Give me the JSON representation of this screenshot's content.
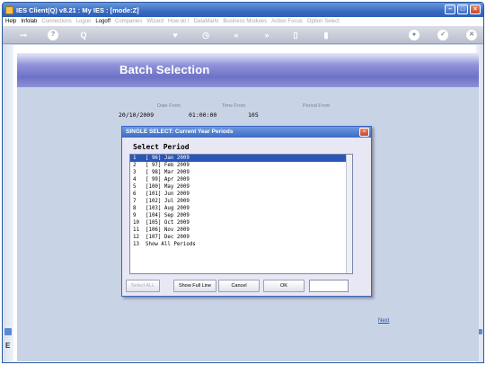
{
  "window": {
    "title": "IES Client(Q) v8.21 : My IES :     [mode:Z]"
  },
  "menubar": {
    "items": [
      {
        "label": "Help",
        "active": true
      },
      {
        "label": "Infolab",
        "active": true
      },
      {
        "label": "Connections",
        "active": false
      },
      {
        "label": "Logon",
        "active": false
      },
      {
        "label": "Logoff",
        "active": true
      },
      {
        "label": "Companies",
        "active": false
      },
      {
        "label": "Wizard",
        "active": false
      },
      {
        "label": "How do I",
        "active": false
      },
      {
        "label": "DataMarts",
        "active": false
      },
      {
        "label": "Business Modules",
        "active": false
      },
      {
        "label": "Action Focus",
        "active": false
      },
      {
        "label": "Option Select",
        "active": false
      }
    ]
  },
  "toolbar": {
    "help_glyph": "?",
    "search_glyph": "Q",
    "rewind_glyph": "«",
    "forward_glyph": "»",
    "clock_glyph": "◷",
    "check_glyph": "✓",
    "close_glyph": "✕"
  },
  "page": {
    "title": "Batch Selection",
    "date_from_label": "Date From",
    "date_from_value": "20/10/2009",
    "time_from_label": "Time From",
    "time_from_value": "01:00:00",
    "period_from_label": "Period From",
    "period_from_value": "105",
    "next_link": "Next"
  },
  "sidebar": {
    "letter": "E"
  },
  "dialog": {
    "title": "SINGLE SELECT: Current Year Periods",
    "heading": "Select Period",
    "rows": [
      "1   [ 96] Jan 2009",
      "2   [ 97] Feb 2009",
      "3   [ 98] Mar 2009",
      "4   [ 99] Apr 2009",
      "5   [100] May 2009",
      "6   [101] Jun 2009",
      "7   [102] Jul 2009",
      "8   [103] Aug 2009",
      "9   [104] Sep 2009",
      "10  [105] Oct 2009",
      "11  [106] Nov 2009",
      "12  [107] Dec 2009",
      "13  Show All Periods"
    ],
    "selected_index": 0,
    "buttons": {
      "select_all": "Select ALL",
      "show_full_line": "Show Full Line",
      "cancel": "Cancel",
      "ok": "OK"
    },
    "filter_value": ""
  }
}
